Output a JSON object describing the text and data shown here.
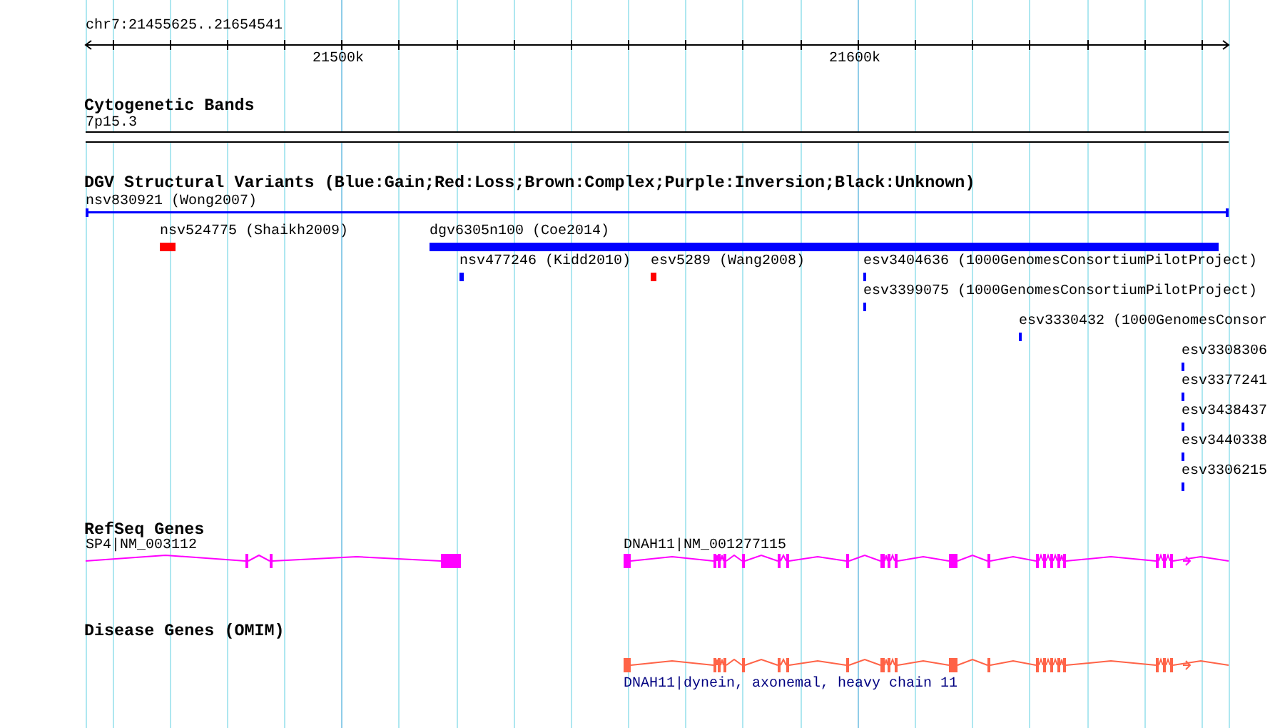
{
  "ruler": {
    "label": "chr7:21455625..21654541",
    "ticks": [
      "21500k",
      "21600k"
    ]
  },
  "tracks": [
    {
      "kind": "cytoband",
      "title": "Cytogenetic Bands",
      "band": "7p15.3"
    },
    {
      "kind": "variants",
      "title": "DGV Structural Variants (Blue:Gain;Red:Loss;Brown:Complex;Purple:Inversion;Black:Unknown)",
      "features": [
        {
          "label": "nsv830921 (Wong2007)",
          "color": "#0000ff"
        },
        {
          "label": "nsv524775 (Shaikh2009)",
          "color": "#ff0000"
        },
        {
          "label": "dgv6305n100 (Coe2014)",
          "color": "#0000ff"
        },
        {
          "label": "nsv477246 (Kidd2010)",
          "color": "#0000ff"
        },
        {
          "label": "esv5289 (Wang2008)",
          "color": "#ff0000"
        },
        {
          "label": "esv3404636 (1000GenomesConsortiumPilotProject)",
          "color": "#0000ff"
        },
        {
          "label": "esv3399075 (1000GenomesConsortiumPilotProject)",
          "color": "#0000ff"
        },
        {
          "label": "esv3330432 (1000GenomesConsor",
          "color": "#0000ff"
        },
        {
          "label": "esv3308306",
          "color": "#0000ff"
        },
        {
          "label": "esv3377241",
          "color": "#0000ff"
        },
        {
          "label": "esv3438437",
          "color": "#0000ff"
        },
        {
          "label": "esv3440338",
          "color": "#0000ff"
        },
        {
          "label": "esv3306215",
          "color": "#0000ff"
        }
      ]
    },
    {
      "kind": "refseq",
      "title": "RefSeq Genes",
      "genes": [
        {
          "label": "SP4|NM_003112",
          "color": "#ff00ff"
        },
        {
          "label": "DNAH11|NM_001277115",
          "color": "#ff00ff"
        }
      ]
    },
    {
      "kind": "omim",
      "title": "Disease Genes (OMIM)",
      "genes": [
        {
          "label": "DNAH11|dynein, axonemal, heavy chain 11",
          "color": "#ff6347"
        }
      ]
    }
  ]
}
